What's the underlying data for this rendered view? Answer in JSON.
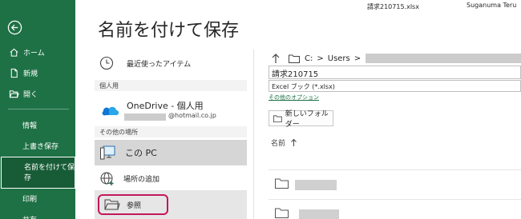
{
  "titlebar": {
    "filename": "請求210715.xlsx",
    "user": "Suganuma Teru"
  },
  "nav": {
    "back_icon": "back-arrow-icon",
    "items": [
      {
        "label": "ホーム",
        "icon": "home-icon"
      },
      {
        "label": "新規",
        "icon": "new-file-icon"
      },
      {
        "label": "開く",
        "icon": "open-folder-icon"
      },
      {
        "label": "情報"
      },
      {
        "label": "上書き保存"
      },
      {
        "label": "名前を付けて保\n存"
      },
      {
        "label": "印刷"
      },
      {
        "label": "共有"
      }
    ]
  },
  "page": {
    "title": "名前を付けて保存"
  },
  "locations": {
    "recent": "最近使ったアイテム",
    "personal_header": "個人用",
    "onedrive_name": "OneDrive - 個人用",
    "onedrive_account": "@hotmail.co.jp",
    "other_header": "その他の場所",
    "this_pc": "この PC",
    "add_place": "場所の追加",
    "browse": "参照"
  },
  "save_panel": {
    "breadcrumb_drive": "C:",
    "breadcrumb_sep": ">",
    "breadcrumb_users": "Users",
    "file_name": "請求210715",
    "file_type": "Excel ブック (*.xlsx)",
    "more_options": "その他のオプション",
    "new_folder": "新しいフォルダー",
    "column_name": "名前"
  },
  "colors": {
    "accent_green": "#1e7145",
    "highlight_ring": "#c2185b"
  }
}
